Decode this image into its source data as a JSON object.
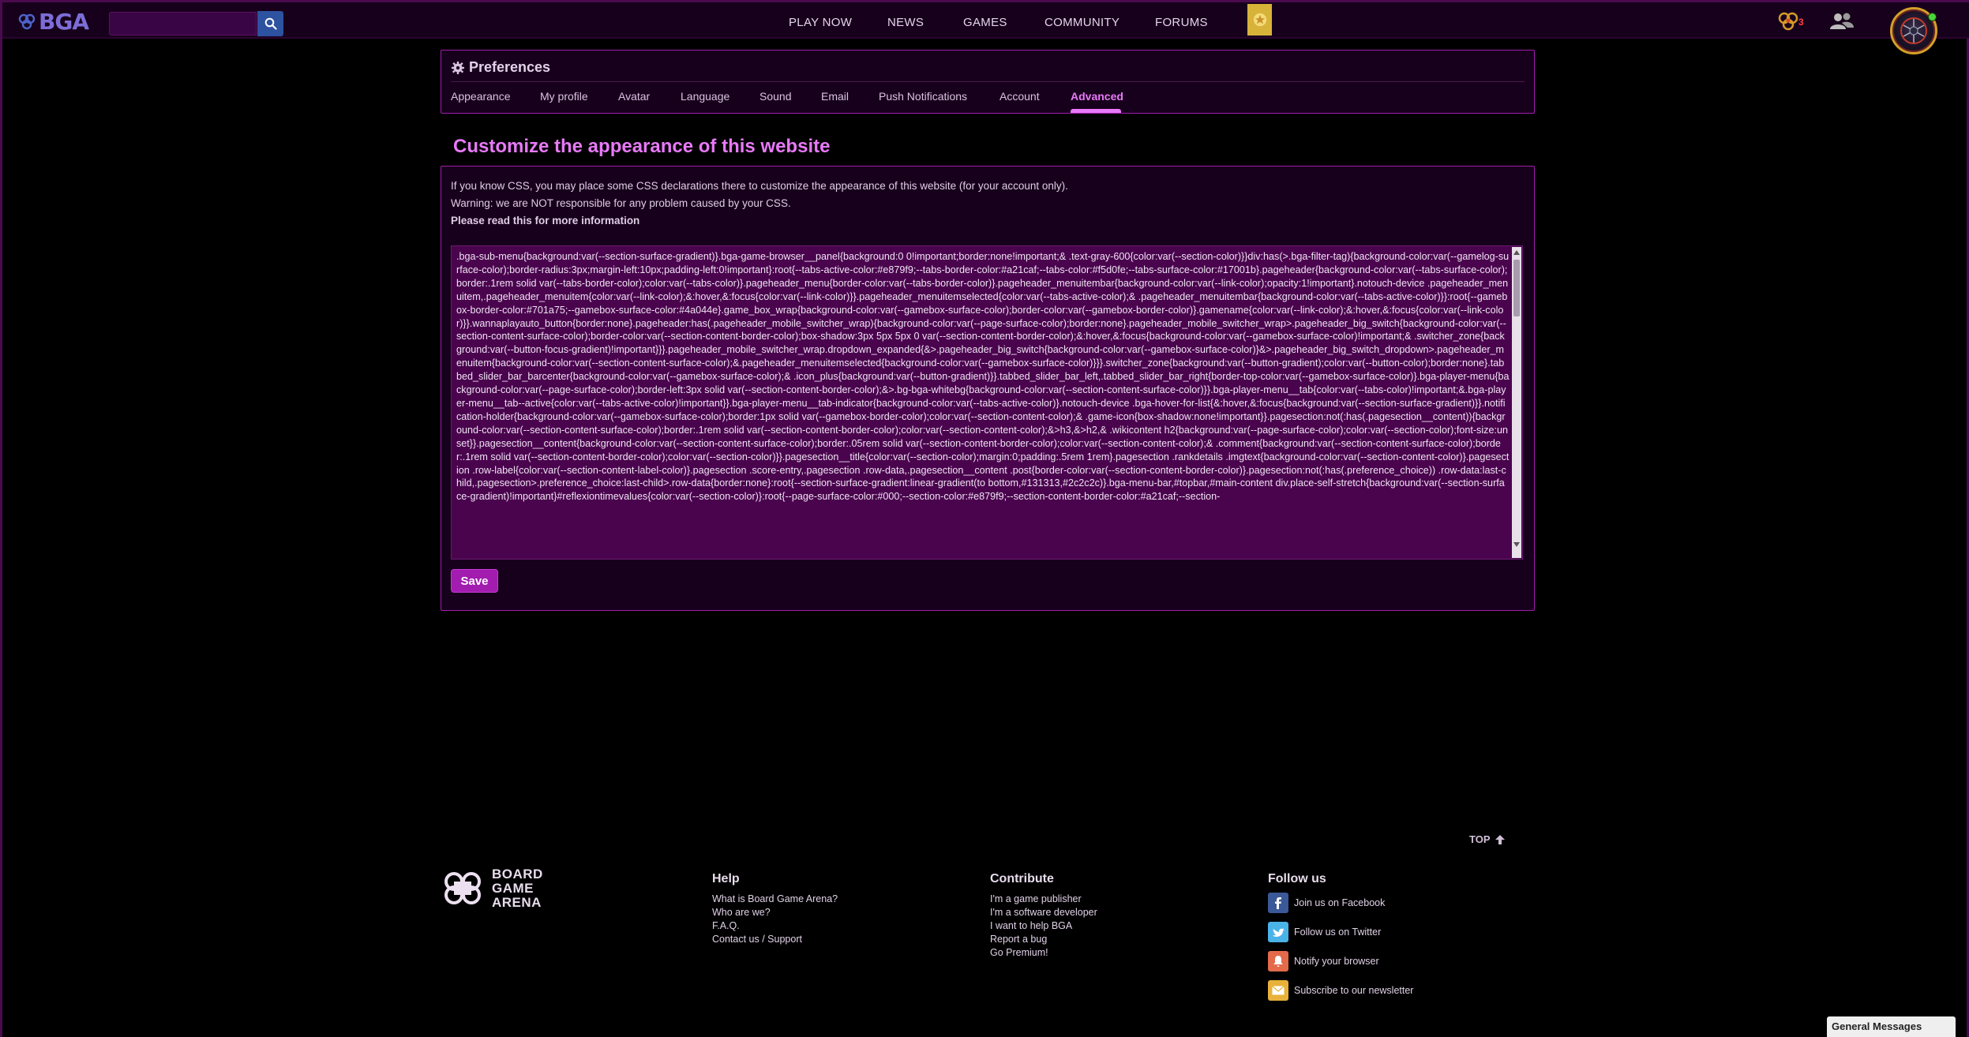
{
  "topbar": {
    "logo_text": "BGA",
    "search_placeholder": "",
    "nav": [
      "PLAY NOW",
      "NEWS",
      "GAMES",
      "COMMUNITY",
      "FORUMS"
    ],
    "notification_count": "3"
  },
  "preferences": {
    "title": "Preferences",
    "tabs": [
      "Appearance",
      "My profile",
      "Avatar",
      "Language",
      "Sound",
      "Email",
      "Push Notifications",
      "Account",
      "Advanced"
    ],
    "active_tab": "Advanced"
  },
  "customize": {
    "heading": "Customize the appearance of this website",
    "line1": "If you know CSS, you may place some CSS declarations there to customize the appearance of this website (for your account only).",
    "line2": "Warning: we are NOT responsible for any problem caused by your CSS.",
    "line3": "Please read this for more information",
    "css_value": ".bga-sub-menu{background:var(--section-surface-gradient)}.bga-game-browser__panel{background:0 0!important;border:none!important;& .text-gray-600{color:var(--section-color)}}div:has(>.bga-filter-tag){background-color:var(--gamelog-surface-color);border-radius:3px;margin-left:10px;padding-left:0!important}:root{--tabs-active-color:#e879f9;--tabs-border-color:#a21caf;--tabs-color:#f5d0fe;--tabs-surface-color:#17001b}.pageheader{background-color:var(--tabs-surface-color);border:.1rem solid var(--tabs-border-color);color:var(--tabs-color)}.pageheader_menu{border-color:var(--tabs-border-color)}.pageheader_menuitembar{background-color:var(--link-color);opacity:1!important}.notouch-device .pageheader_menuitem,.pageheader_menuitem{color:var(--link-color);&:hover,&:focus{color:var(--link-color)}}.pageheader_menuitemselected{color:var(--tabs-active-color);& .pageheader_menuitembar{background-color:var(--tabs-active-color)}}:root{--gamebox-border-color:#701a75;--gamebox-surface-color:#4a044e}.game_box_wrap{background-color:var(--gamebox-surface-color);border-color:var(--gamebox-border-color)}.gamename{color:var(--link-color);&:hover,&:focus{color:var(--link-color)}}.wannaplayauto_button{border:none}.pageheader:has(.pageheader_mobile_switcher_wrap){background-color:var(--page-surface-color);border:none}.pageheader_mobile_switcher_wrap>.pageheader_big_switch{background-color:var(--section-content-surface-color);border-color:var(--section-content-border-color);box-shadow:3px 5px 5px 0 var(--section-content-border-color);&:hover,&:focus{background-color:var(--gamebox-surface-color)!important;& .switcher_zone{background:var(--button-focus-gradient)!important}}}.pageheader_mobile_switcher_wrap.dropdown_expanded{&>.pageheader_big_switch{background-color:var(--gamebox-surface-color)}&>.pageheader_big_switch_dropdown>.pageheader_menuitem{background-color:var(--section-content-surface-color);&.pageheader_menuitemselected{background-color:var(--gamebox-surface-color)}}}.switcher_zone{background:var(--button-gradient);color:var(--button-color);border:none}.tabbed_slider_bar_barcenter{background-color:var(--gamebox-surface-color);& .icon_plus{background:var(--button-gradient)}}.tabbed_slider_bar_left,.tabbed_slider_bar_right{border-top-color:var(--gamebox-surface-color)}.bga-player-menu{background-color:var(--page-surface-color);border-left:3px solid var(--section-content-border-color);&>.bg-bga-whitebg{background-color:var(--section-content-surface-color)}}.bga-player-menu__tab{color:var(--tabs-color)!important;&.bga-player-menu__tab--active{color:var(--tabs-active-color)!important}}.bga-player-menu__tab-indicator{background-color:var(--tabs-active-color)}.notouch-device .bga-hover-for-list{&:hover,&:focus{background:var(--section-surface-gradient)}}.notification-holder{background-color:var(--gamebox-surface-color);border:1px solid var(--gamebox-border-color);color:var(--section-content-color);& .game-icon{box-shadow:none!important}}.pagesection:not(:has(.pagesection__content)){background-color:var(--section-content-surface-color);border:.1rem solid var(--section-content-border-color);color:var(--section-content-color);&>h3,&>h2,& .wikicontent h2{background:var(--page-surface-color);color:var(--section-color);font-size:unset}}.pagesection__content{background-color:var(--section-content-surface-color);border:.05rem solid var(--section-content-border-color);color:var(--section-content-color);& .comment{background:var(--section-content-surface-color);border:.1rem solid var(--section-content-border-color);color:var(--section-color)}}.pagesection__title{color:var(--section-color);margin:0;padding:.5rem 1rem}.pagesection .rankdetails .imgtext{background-color:var(--section-content-color)}.pagesection .row-label{color:var(--section-content-label-color)}.pagesection .score-entry,.pagesection .row-data,.pagesection__content .post{border-color:var(--section-content-border-color)}.pagesection:not(:has(.preference_choice)) .row-data:last-child,.pagesection>.preference_choice:last-child>.row-data{border:none}:root{--section-surface-gradient:linear-gradient(to bottom,#131313,#2c2c2c)}.bga-menu-bar,#topbar,#main-content div.place-self-stretch{background:var(--section-surface-gradient)!important}#reflexiontimevalues{color:var(--section-color)}:root{--page-surface-color:#000;--section-color:#e879f9;--section-content-border-color:#a21caf;--section-",
    "save_label": "Save"
  },
  "footer": {
    "top_label": "TOP",
    "logo_line1": "BOARD",
    "logo_line2": "GAME",
    "logo_line3": "ARENA",
    "help": {
      "title": "Help",
      "links": [
        "What is Board Game Arena?",
        "Who are we?",
        "F.A.Q.",
        "Contact us / Support"
      ]
    },
    "contribute": {
      "title": "Contribute",
      "links": [
        "I'm a game publisher",
        "I'm a software developer",
        "I want to help BGA",
        "Report a bug",
        "Go Premium!"
      ]
    },
    "follow": {
      "title": "Follow us",
      "links": [
        "Join us on Facebook",
        "Follow us on Twitter",
        "Notify your browser",
        "Subscribe to our newsletter"
      ]
    }
  },
  "general_messages_label": "General Messages",
  "colors": {
    "accent": "#e879f9",
    "border": "#a21caf",
    "surface": "#17001b",
    "textarea": "#4a044e"
  }
}
